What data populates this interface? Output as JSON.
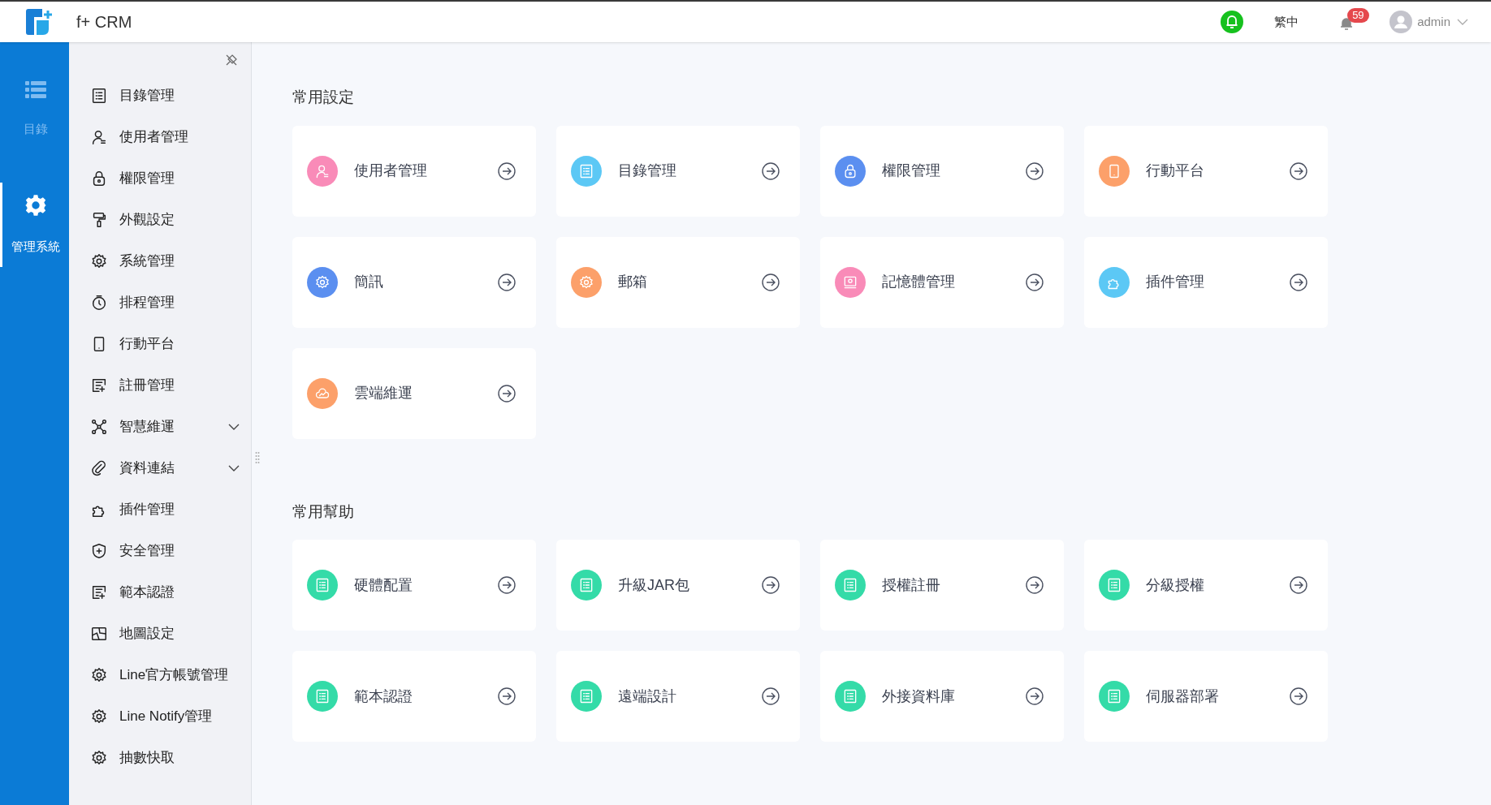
{
  "header": {
    "app_title": "f+ CRM",
    "language": "繁中",
    "notification_count": "59",
    "user": "admin"
  },
  "rail": [
    {
      "label": "目錄",
      "kind": "list",
      "selected": false
    },
    {
      "label": "管理系統",
      "kind": "gear",
      "selected": true
    }
  ],
  "menu": [
    {
      "label": "目錄管理",
      "kind": "list",
      "expandable": false
    },
    {
      "label": "使用者管理",
      "kind": "user",
      "expandable": false
    },
    {
      "label": "權限管理",
      "kind": "lock",
      "expandable": false
    },
    {
      "label": "外觀設定",
      "kind": "roller",
      "expandable": false
    },
    {
      "label": "系統管理",
      "kind": "gear",
      "expandable": false
    },
    {
      "label": "排程管理",
      "kind": "timer",
      "expandable": false
    },
    {
      "label": "行動平台",
      "kind": "mobile",
      "expandable": false
    },
    {
      "label": "註冊管理",
      "kind": "form",
      "expandable": false
    },
    {
      "label": "智慧維運",
      "kind": "nodes",
      "expandable": true
    },
    {
      "label": "資料連結",
      "kind": "clip",
      "expandable": true
    },
    {
      "label": "插件管理",
      "kind": "puzzle",
      "expandable": false
    },
    {
      "label": "安全管理",
      "kind": "shield",
      "expandable": false
    },
    {
      "label": "範本認證",
      "kind": "form",
      "expandable": false
    },
    {
      "label": "地圖設定",
      "kind": "map",
      "expandable": false
    },
    {
      "label": "Line官方帳號管理",
      "kind": "gear",
      "expandable": false
    },
    {
      "label": "Line Notify管理",
      "kind": "gear",
      "expandable": false
    },
    {
      "label": "抽數快取",
      "kind": "gear",
      "expandable": false
    }
  ],
  "sections": [
    {
      "title": "常用設定",
      "cards": [
        {
          "label": "使用者管理",
          "kind": "user",
          "color": "#f98bb8"
        },
        {
          "label": "目錄管理",
          "kind": "list",
          "color": "#5cc8f5"
        },
        {
          "label": "權限管理",
          "kind": "lock",
          "color": "#5b8ff0"
        },
        {
          "label": "行動平台",
          "kind": "mobile",
          "color": "#fca06a"
        },
        {
          "label": "簡訊",
          "kind": "gear",
          "color": "#5b8ff0"
        },
        {
          "label": "郵箱",
          "kind": "gear",
          "color": "#fca06a"
        },
        {
          "label": "記憶體管理",
          "kind": "screen",
          "color": "#f98bb8"
        },
        {
          "label": "插件管理",
          "kind": "puzzle",
          "color": "#5cc8f5"
        },
        {
          "label": "雲端維運",
          "kind": "cloud",
          "color": "#fca06a"
        }
      ]
    },
    {
      "title": "常用幫助",
      "cards": [
        {
          "label": "硬體配置",
          "kind": "list",
          "color": "#34dba8"
        },
        {
          "label": "升級JAR包",
          "kind": "list",
          "color": "#34dba8"
        },
        {
          "label": "授權註冊",
          "kind": "list",
          "color": "#34dba8"
        },
        {
          "label": "分級授權",
          "kind": "list",
          "color": "#34dba8"
        },
        {
          "label": "範本認證",
          "kind": "list",
          "color": "#34dba8"
        },
        {
          "label": "遠端設計",
          "kind": "list",
          "color": "#34dba8"
        },
        {
          "label": "外接資料庫",
          "kind": "list",
          "color": "#34dba8"
        },
        {
          "label": "伺服器部署",
          "kind": "list",
          "color": "#34dba8"
        }
      ]
    }
  ]
}
